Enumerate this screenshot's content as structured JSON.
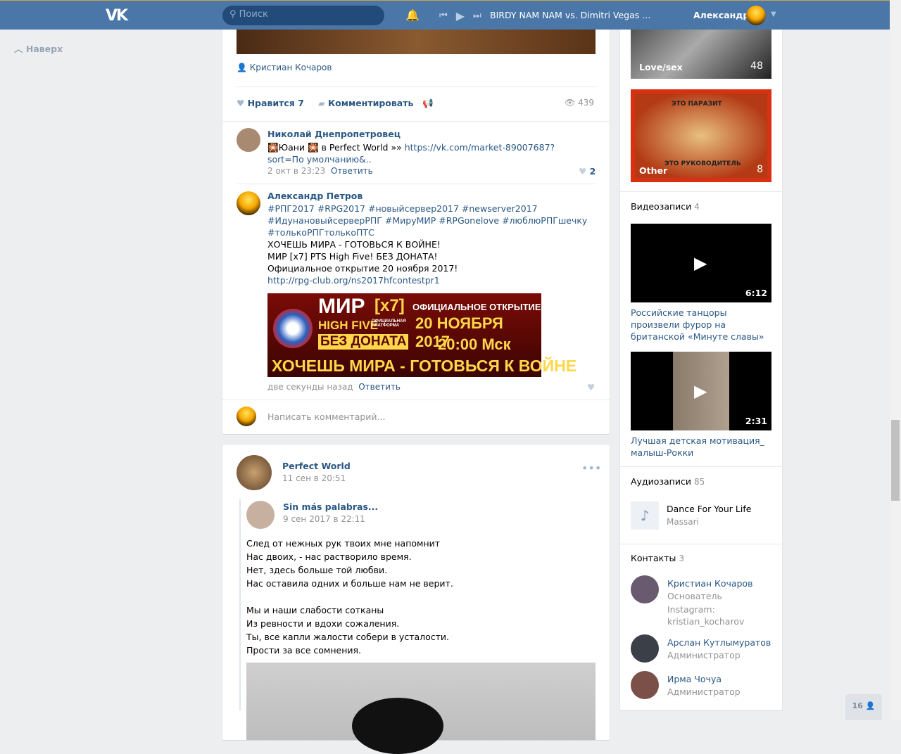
{
  "header": {
    "search_placeholder": "Поиск",
    "track": "BIRDY NAM NAM vs. Dimitri Vegas ...",
    "user": "Александр"
  },
  "sidebar": {
    "up": "Наверх"
  },
  "post1": {
    "author_credit": "Кристиан Кочаров",
    "like_label": "Нравится",
    "like_count": "7",
    "comment_label": "Комментировать",
    "views": "439",
    "comments": [
      {
        "name": "Николай Днепропетровец",
        "text_pre": "Юани",
        "text_mid": " в Perfect World »» ",
        "link": "https://vk.com/market-89007687?sort=По умолчанию&..",
        "date": "2 окт в 23:23",
        "reply": "Ответить",
        "likes": "2"
      },
      {
        "name": "Александр Петров",
        "tags1": "#РПГ2017 #RPG2017 #новыйсервер2017 #newserver2017",
        "tags2": "#ИдунановыйсерверРПГ #МируМИР #RPGonelove #люблюРПГшечку",
        "tags3": "#толькоРПГтолькоПТС",
        "line1": "ХОЧЕШЬ МИРА - ГОТОВЬСЯ К ВОЙНЕ!",
        "line2": "МИР [x7] PTS High Five! БЕЗ ДОНАТА!",
        "line3": "Официальное открытие 20 ноября 2017!",
        "link": "http://rpg-club.org/ns2017hfcontestpr1",
        "date": "две секунды назад",
        "reply": "Ответить",
        "banner": {
          "title": "МИР",
          "rate": "[x7]",
          "sub": "HIGH FIVE",
          "platform": "ОФИЦИАЛЬНАЯ ПЛАТФОРМА",
          "nodonate": "БЕЗ ДОНАТА",
          "open": "ОФИЦИАЛЬНОЕ ОТКРЫТИЕ",
          "date": "20 НОЯБРЯ 2017",
          "time": "20:00 Мск",
          "slogan": "ХОЧЕШЬ МИРА - ГОТОВЬСЯ К ВОЙНЕ"
        }
      }
    ],
    "write_placeholder": "Написать комментарий..."
  },
  "post2": {
    "author": "Perfect World",
    "date": "11 сен в 20:51",
    "repost_author": "Sin más palabras...",
    "repost_date": "9 сен 2017 в 22:11",
    "lines": [
      "След от нежных рук твоих мне напомнит",
      "Нас двоих, - нас растворило время.",
      "Нет, здесь больше той любви.",
      "Нас оставила одних и больше нам не верит.",
      "",
      "Мы и наши слабости сотканы",
      "Из ревности и вдохи сожаления.",
      "Ты, все капли жалости собери в усталости.",
      "Прости за все сомнения."
    ]
  },
  "right": {
    "albums": [
      {
        "label": "Love/sex",
        "count": "48"
      },
      {
        "label": "Other",
        "count": "8",
        "caption_top": "ЭТО ПАРАЗИТ",
        "caption_bottom": "ЭТО РУКОВОДИТЕЛЬ"
      }
    ],
    "videos_title": "Видеозаписи",
    "videos_count": "4",
    "videos": [
      {
        "duration": "6:12",
        "title": "Российские танцоры произвели фурор на британской «Минуте славы»"
      },
      {
        "duration": "2:31",
        "title": "Лучшая детская мотивация_ малыш-Рокки"
      }
    ],
    "audio_title": "Аудиозаписи",
    "audio_count": "85",
    "audio": {
      "title": "Dance For Your Life",
      "artist": "Massari"
    },
    "contacts_title": "Контакты",
    "contacts_count": "3",
    "contacts": [
      {
        "name": "Кристиан Кочаров",
        "role": "Основатель",
        "extra1": "Instagram:",
        "extra2": "kristian_kocharov"
      },
      {
        "name": "Арслан Кутлымуратов",
        "role": "Администратор"
      },
      {
        "name": "Ирма Чочуа",
        "role": "Администратор"
      }
    ]
  },
  "online_count": "16"
}
